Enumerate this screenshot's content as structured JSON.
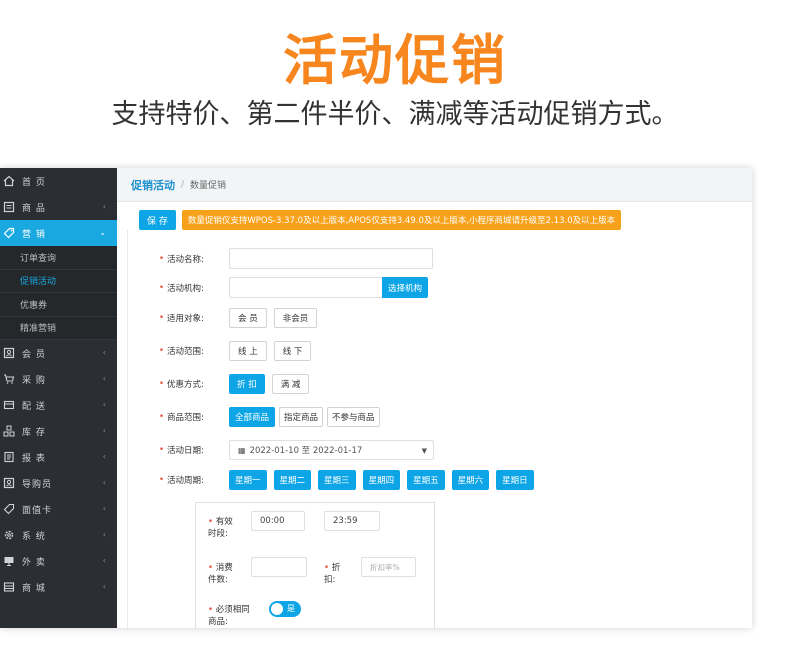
{
  "banner": {
    "title": "活动促销",
    "subtitle": "支持特价、第二件半价、满减等活动促销方式。"
  },
  "sidebar": {
    "items": [
      {
        "label": "首 页",
        "icon": "home-icon"
      },
      {
        "label": "商 品",
        "icon": "list-icon"
      },
      {
        "label": "营 销",
        "icon": "tag-icon"
      },
      {
        "label": "会 员",
        "icon": "member-card-icon"
      },
      {
        "label": "采 购",
        "icon": "cart-icon"
      },
      {
        "label": "配 送",
        "icon": "delivery-icon"
      },
      {
        "label": "库 存",
        "icon": "stock-icon"
      },
      {
        "label": "报 表",
        "icon": "report-icon"
      },
      {
        "label": "导购员",
        "icon": "guide-icon"
      },
      {
        "label": "面值卡",
        "icon": "card-icon"
      },
      {
        "label": "系 统",
        "icon": "gear-icon"
      },
      {
        "label": "外 卖",
        "icon": "monitor-icon"
      },
      {
        "label": "商 城",
        "icon": "mall-icon"
      }
    ],
    "submenu": [
      "订单查询",
      "促销活动",
      "优惠券",
      "精准营销"
    ]
  },
  "breadcrumb": {
    "main": "促销活动",
    "sep": "/",
    "current": "数量促销"
  },
  "toolbar": {
    "save_label": "保 存",
    "notice": "数量促销仅支持WPOS-3.37.0及以上版本,APOS仅支持3.49.0及以上版本,小程序商城请升级至2.13.0及以上版本"
  },
  "form": {
    "name_label": "活动名称:",
    "org_label": "活动机构:",
    "org_button": "选择机构",
    "target_label": "适用对象:",
    "target_options": [
      "会 员",
      "非会员"
    ],
    "scope_label": "活动范围:",
    "scope_options": [
      "线 上",
      "线 下"
    ],
    "discount_label": "优惠方式:",
    "discount_options": [
      "折 扣",
      "满 减"
    ],
    "goods_label": "商品范围:",
    "goods_options": [
      "全部商品",
      "指定商品",
      "不参与商品"
    ],
    "date_label": "活动日期:",
    "date_value": "2022-01-10 至 2022-01-17",
    "week_label": "活动周期:",
    "week_days": [
      "星期一",
      "星期二",
      "星期三",
      "星期四",
      "星期五",
      "星期六",
      "星期日"
    ]
  },
  "rule_box": {
    "time_label_1": "有效",
    "time_label_2": "时段:",
    "time_start": "00:00",
    "time_end": "23:59",
    "qty_label_1": "消费",
    "qty_label_2": "件数:",
    "disc_label_1": "折",
    "disc_label_2": "扣:",
    "disc_placeholder": "折扣率%",
    "same_label_1": "必须相同",
    "same_label_2": "商品:",
    "toggle_text": "是"
  },
  "colors": {
    "accent": "#0ea5e6",
    "brand_orange": "#f7861f",
    "notice": "#f7a21a",
    "sidebar": "#2b2f33"
  }
}
